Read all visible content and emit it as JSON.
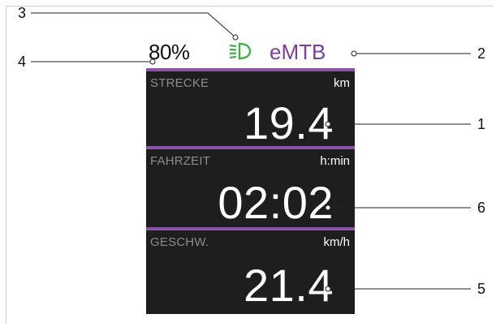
{
  "header": {
    "battery": "80%",
    "mode": "eMTB",
    "light_icon": "headlight-icon"
  },
  "panels": [
    {
      "label": "STRECKE",
      "unit": "km",
      "value": "19.4"
    },
    {
      "label": "FAHRZEIT",
      "unit": "h:min",
      "value": "02:02"
    },
    {
      "label": "GESCHW.",
      "unit": "km/h",
      "value": "21.4"
    }
  ],
  "callouts": {
    "c1": "1",
    "c2": "2",
    "c3": "3",
    "c4": "4",
    "c5": "5",
    "c6": "6"
  },
  "colors": {
    "accent": "#8a55a8",
    "mode_text": "#7b3f98",
    "light": "#3db14a",
    "panel_bg": "#1e1e1e"
  }
}
